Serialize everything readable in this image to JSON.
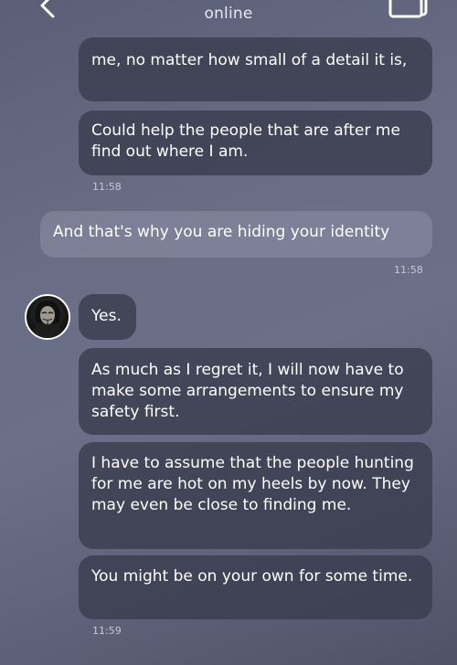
{
  "header": {
    "status": "online",
    "back_icon": "chevron-left-icon",
    "menu_icon": "stacked-cards-icon"
  },
  "messages": {
    "m1_text": "me, no matter how small of a detail it is,",
    "m2_text": "Could help the people that are after me find out where I am.",
    "m2_time": "11:58",
    "m3_text": "And that's why you are hiding your identity",
    "m3_time": "11:58",
    "m4_text": "Yes.",
    "m5_text": "As much as I regret it, I will now have to make some arrangements to ensure my safety first.",
    "m6_text": "I have to assume that the people hunting for me are hot on my heels by now. They may even be close to finding me.",
    "m7_text": "You might be on your own for some time.",
    "m7_time": "11:59"
  },
  "colors": {
    "background": "#62657e",
    "received_bubble": "#3a3c4e",
    "sent_bubble": "#8c8fa5"
  }
}
